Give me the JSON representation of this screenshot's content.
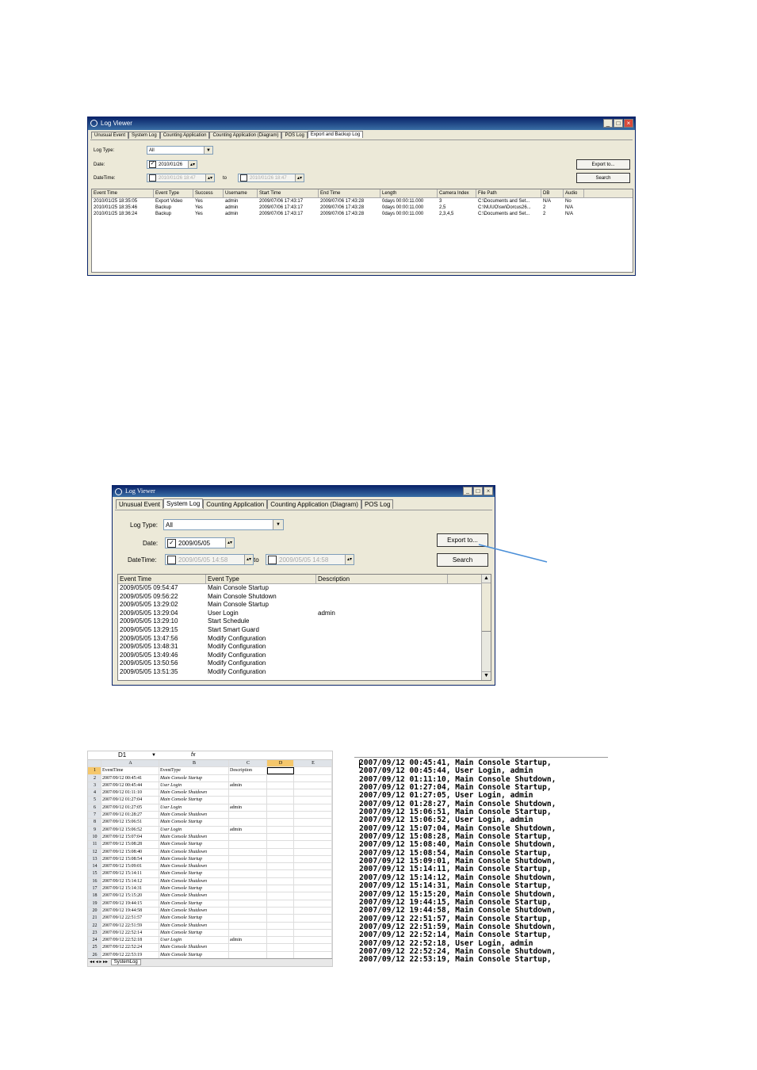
{
  "viewer1": {
    "title": "Log Viewer",
    "tabs": [
      "Unusual Event",
      "System Log",
      "Counting Application",
      "Counting Application (Diagram)",
      "POS Log",
      "Export and Backup Log"
    ],
    "log_type_label": "Log Type:",
    "log_type_value": "All",
    "date_label": "Date:",
    "date_value": "2010/01/26",
    "datetime_label": "DateTime:",
    "datetime_from": "2010/01/26 18:47",
    "to_label": "to",
    "datetime_to": "2010/01/26 18:47",
    "export_label": "Export to...",
    "search_label": "Search",
    "columns": [
      "Event Time",
      "Event Type",
      "Success",
      "Username",
      "Start Time",
      "End Time",
      "Length",
      "Camera Index",
      "File Path",
      "DB",
      "Audio"
    ],
    "rows": [
      [
        "2010/01/25 18:35:05",
        "Export Video",
        "Yes",
        "admin",
        "2009/07/06 17:43:17",
        "2009/07/06 17:43:28",
        "0days 00:00:11.000",
        "3",
        "C:\\Documents and Set...",
        "N/A",
        "No"
      ],
      [
        "2010/01/25 18:35:46",
        "Backup",
        "Yes",
        "admin",
        "2009/07/06 17:43:17",
        "2009/07/06 17:43:28",
        "0days 00:00:11.000",
        "2,5",
        "C:\\NUUO\\sw\\Dorcus26...",
        "2",
        "N/A"
      ],
      [
        "2010/01/25 18:36:24",
        "Backup",
        "Yes",
        "admin",
        "2009/07/06 17:43:17",
        "2009/07/06 17:43:28",
        "0days 00:00:11.000",
        "2,3,4,5",
        "C:\\Documents and Set...",
        "2",
        "N/A"
      ]
    ]
  },
  "viewer2": {
    "title": "Log Viewer",
    "tabs": [
      "Unusual Event",
      "System Log",
      "Counting Application",
      "Counting Application (Diagram)",
      "POS Log"
    ],
    "log_type_label": "Log Type:",
    "log_type_value": "All",
    "date_label": "Date:",
    "date_value": "2009/05/05",
    "datetime_label": "DateTime:",
    "datetime_from": "2009/05/05 14:58",
    "to_label": "to",
    "datetime_to": "2009/05/05 14:58",
    "export_label": "Export to...",
    "search_label": "Search",
    "columns": [
      "Event Time",
      "Event Type",
      "Description"
    ],
    "rows": [
      [
        "2009/05/05 09:54:47",
        "Main Console Startup",
        ""
      ],
      [
        "2009/05/05 09:56:22",
        "Main Console Shutdown",
        ""
      ],
      [
        "2009/05/05 13:29:02",
        "Main Console Startup",
        ""
      ],
      [
        "2009/05/05 13:29:04",
        "User Login",
        "admin"
      ],
      [
        "2009/05/05 13:29:10",
        "Start Schedule",
        ""
      ],
      [
        "2009/05/05 13:29:15",
        "Start Smart Guard",
        ""
      ],
      [
        "2009/05/05 13:47:56",
        "Modify Configuration",
        ""
      ],
      [
        "2009/05/05 13:48:31",
        "Modify Configuration",
        ""
      ],
      [
        "2009/05/05 13:49:46",
        "Modify Configuration",
        ""
      ],
      [
        "2009/05/05 13:50:56",
        "Modify Configuration",
        ""
      ],
      [
        "2009/05/05 13:51:35",
        "Modify Configuration",
        ""
      ]
    ]
  },
  "spreadsheet": {
    "cell_ref": "D1",
    "fx": "fx",
    "columns": [
      "A",
      "B",
      "C",
      "D",
      "E"
    ],
    "header": [
      "EventTime",
      "EventType",
      "Description"
    ],
    "rows": [
      [
        "2007/09/12 00:45:41",
        "Main Console Startup",
        ""
      ],
      [
        "2007/09/12 00:45:44",
        "User Login",
        "admin"
      ],
      [
        "2007/09/12 01:11:10",
        "Main Console Shutdown",
        ""
      ],
      [
        "2007/09/12 01:27:04",
        "Main Console Startup",
        ""
      ],
      [
        "2007/09/12 01:27:05",
        "User Login",
        "admin"
      ],
      [
        "2007/09/12 01:28:27",
        "Main Console Shutdown",
        ""
      ],
      [
        "2007/09/12 15:06:51",
        "Main Console Startup",
        ""
      ],
      [
        "2007/09/12 15:06:52",
        "User Login",
        "admin"
      ],
      [
        "2007/09/12 15:07:04",
        "Main Console Shutdown",
        ""
      ],
      [
        "2007/09/12 15:08:28",
        "Main Console Startup",
        ""
      ],
      [
        "2007/09/12 15:08:40",
        "Main Console Shutdown",
        ""
      ],
      [
        "2007/09/12 15:08:54",
        "Main Console Startup",
        ""
      ],
      [
        "2007/09/12 15:09:01",
        "Main Console Shutdown",
        ""
      ],
      [
        "2007/09/12 15:14:11",
        "Main Console Startup",
        ""
      ],
      [
        "2007/09/12 15:14:12",
        "Main Console Shutdown",
        ""
      ],
      [
        "2007/09/12 15:14:31",
        "Main Console Startup",
        ""
      ],
      [
        "2007/09/12 15:15:20",
        "Main Console Shutdown",
        ""
      ],
      [
        "2007/09/12 19:44:15",
        "Main Console Startup",
        ""
      ],
      [
        "2007/09/12 19:44:58",
        "Main Console Shutdown",
        ""
      ],
      [
        "2007/09/12 22:51:57",
        "Main Console Startup",
        ""
      ],
      [
        "2007/09/12 22:51:59",
        "Main Console Shutdown",
        ""
      ],
      [
        "2007/09/12 22:52:14",
        "Main Console Startup",
        ""
      ],
      [
        "2007/09/12 22:52:18",
        "User Login",
        "admin"
      ],
      [
        "2007/09/12 22:52:24",
        "Main Console Shutdown",
        ""
      ],
      [
        "2007/09/12 22:53:19",
        "Main Console Startup",
        ""
      ]
    ],
    "sheet_tab": "SystemLog"
  },
  "text_export": [
    "2007/09/12 00:45:41, Main Console Startup,",
    "2007/09/12 00:45:44, User Login, admin",
    "2007/09/12 01:11:10, Main Console Shutdown,",
    "2007/09/12 01:27:04, Main Console Startup,",
    "2007/09/12 01:27:05, User Login, admin",
    "2007/09/12 01:28:27, Main Console Shutdown,",
    "2007/09/12 15:06:51, Main Console Startup,",
    "2007/09/12 15:06:52, User Login, admin",
    "2007/09/12 15:07:04, Main Console Shutdown,",
    "2007/09/12 15:08:28, Main Console Startup,",
    "2007/09/12 15:08:40, Main Console Shutdown,",
    "2007/09/12 15:08:54, Main Console Startup,",
    "2007/09/12 15:09:01, Main Console Shutdown,",
    "2007/09/12 15:14:11, Main Console Startup,",
    "2007/09/12 15:14:12, Main Console Shutdown,",
    "2007/09/12 15:14:31, Main Console Startup,",
    "2007/09/12 15:15:20, Main Console Shutdown,",
    "2007/09/12 19:44:15, Main Console Startup,",
    "2007/09/12 19:44:58, Main Console Shutdown,",
    "2007/09/12 22:51:57, Main Console Startup,",
    "2007/09/12 22:51:59, Main Console Shutdown,",
    "2007/09/12 22:52:14, Main Console Startup,",
    "2007/09/12 22:52:18, User Login, admin",
    "2007/09/12 22:52:24, Main Console Shutdown,",
    "2007/09/12 22:53:19, Main Console Startup,"
  ]
}
